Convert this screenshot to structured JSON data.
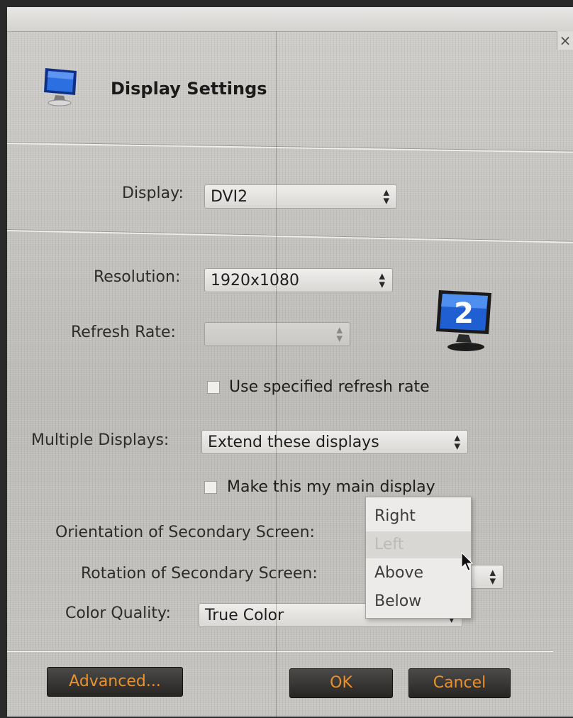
{
  "dialog": {
    "title": "Display Settings"
  },
  "display": {
    "label": "Display:",
    "value": "DVI2"
  },
  "resolution": {
    "label": "Resolution:",
    "value": "1920x1080"
  },
  "refresh_rate": {
    "label": "Refresh Rate:",
    "value": ""
  },
  "use_refresh": {
    "label": "Use specified refresh rate",
    "checked": false
  },
  "multiple_displays": {
    "label": "Multiple Displays:",
    "value": "Extend these displays"
  },
  "main_display": {
    "label": "Make this my main display",
    "checked": false
  },
  "orientation": {
    "label": "Orientation of Secondary Screen:",
    "options": [
      "Right",
      "Left",
      "Above",
      "Below"
    ],
    "selected": "Left"
  },
  "rotation": {
    "label": "Rotation of Secondary Screen:"
  },
  "color_quality": {
    "label": "Color Quality:",
    "value": "True Color"
  },
  "buttons": {
    "advanced": "Advanced...",
    "ok": "OK",
    "cancel": "Cancel"
  },
  "monitor_badge": "2",
  "icons": {
    "close": "close-icon",
    "monitor": "monitor-icon",
    "spin_arrows": "updown-arrows-icon",
    "pointer": "mouse-pointer-icon"
  },
  "colors": {
    "button_text": "#e8922e",
    "button_bg": "#2e2d2b",
    "monitor_blue": "#1f5fd1"
  }
}
